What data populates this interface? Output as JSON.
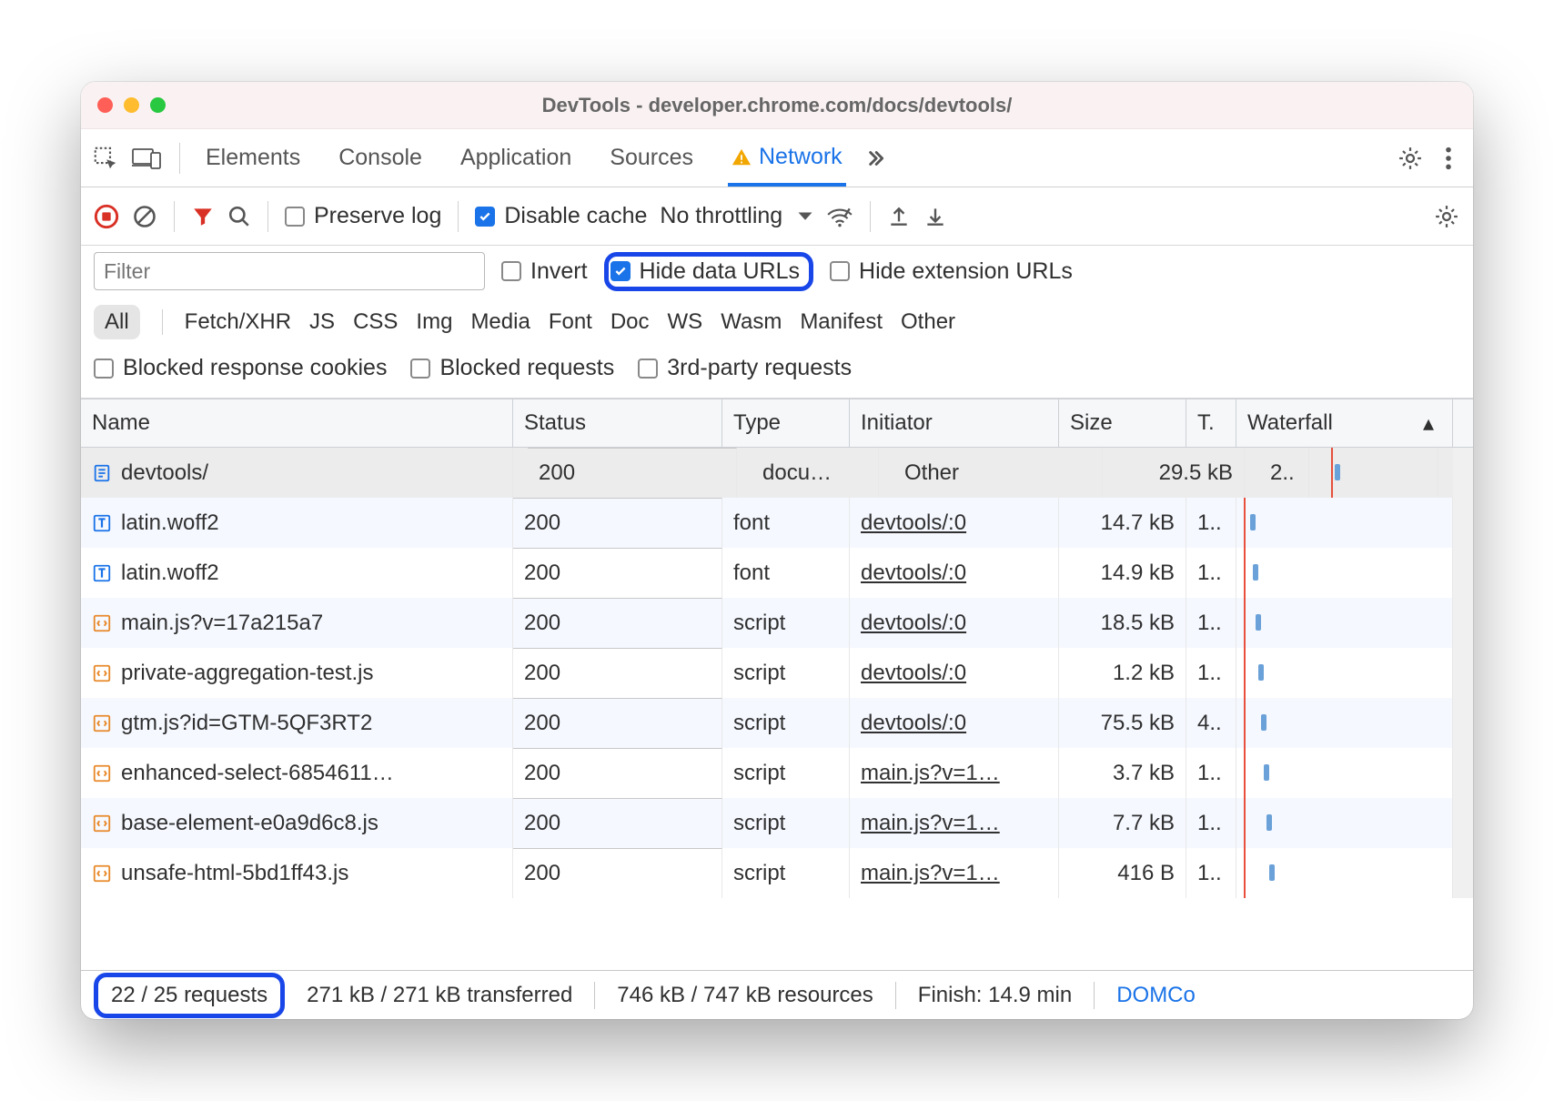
{
  "titlebar": {
    "title": "DevTools - developer.chrome.com/docs/devtools/"
  },
  "tabs": {
    "items": [
      "Elements",
      "Console",
      "Application",
      "Sources",
      "Network"
    ],
    "active": "Network"
  },
  "toolbar": {
    "preserve_log": "Preserve log",
    "disable_cache": "Disable cache",
    "throttling": "No throttling"
  },
  "filters": {
    "placeholder": "Filter",
    "invert": "Invert",
    "hide_data_urls": "Hide data URLs",
    "hide_ext_urls": "Hide extension URLs",
    "types": [
      "All",
      "Fetch/XHR",
      "JS",
      "CSS",
      "Img",
      "Media",
      "Font",
      "Doc",
      "WS",
      "Wasm",
      "Manifest",
      "Other"
    ],
    "blocked_cookies": "Blocked response cookies",
    "blocked_requests": "Blocked requests",
    "third_party": "3rd-party requests"
  },
  "columns": {
    "name": "Name",
    "status": "Status",
    "type": "Type",
    "initiator": "Initiator",
    "size": "Size",
    "time": "T.",
    "waterfall": "Waterfall"
  },
  "rows": [
    {
      "icon": "doc",
      "name": "devtools/",
      "status": "200",
      "type": "docu…",
      "initiator": "Other",
      "initiator_link": false,
      "size": "29.5 kB",
      "time": "2..",
      "selected": true
    },
    {
      "icon": "font",
      "name": "latin.woff2",
      "status": "200",
      "type": "font",
      "initiator": "devtools/:0",
      "initiator_link": true,
      "size": "14.7 kB",
      "time": "1.."
    },
    {
      "icon": "font",
      "name": "latin.woff2",
      "status": "200",
      "type": "font",
      "initiator": "devtools/:0",
      "initiator_link": true,
      "size": "14.9 kB",
      "time": "1.."
    },
    {
      "icon": "js",
      "name": "main.js?v=17a215a7",
      "status": "200",
      "type": "script",
      "initiator": "devtools/:0",
      "initiator_link": true,
      "size": "18.5 kB",
      "time": "1.."
    },
    {
      "icon": "js",
      "name": "private-aggregation-test.js",
      "status": "200",
      "type": "script",
      "initiator": "devtools/:0",
      "initiator_link": true,
      "size": "1.2 kB",
      "time": "1.."
    },
    {
      "icon": "js",
      "name": "gtm.js?id=GTM-5QF3RT2",
      "status": "200",
      "type": "script",
      "initiator": "devtools/:0",
      "initiator_link": true,
      "size": "75.5 kB",
      "time": "4.."
    },
    {
      "icon": "js",
      "name": "enhanced-select-6854611…",
      "status": "200",
      "type": "script",
      "initiator": "main.js?v=1…",
      "initiator_link": true,
      "size": "3.7 kB",
      "time": "1.."
    },
    {
      "icon": "js",
      "name": "base-element-e0a9d6c8.js",
      "status": "200",
      "type": "script",
      "initiator": "main.js?v=1…",
      "initiator_link": true,
      "size": "7.7 kB",
      "time": "1.."
    },
    {
      "icon": "js",
      "name": "unsafe-html-5bd1ff43.js",
      "status": "200",
      "type": "script",
      "initiator": "main.js?v=1…",
      "initiator_link": true,
      "size": "416 B",
      "time": "1.."
    }
  ],
  "statusbar": {
    "requests": "22 / 25 requests",
    "transferred": "271 kB / 271 kB transferred",
    "resources": "746 kB / 747 kB resources",
    "finish": "Finish: 14.9 min",
    "domco": "DOMCo"
  }
}
